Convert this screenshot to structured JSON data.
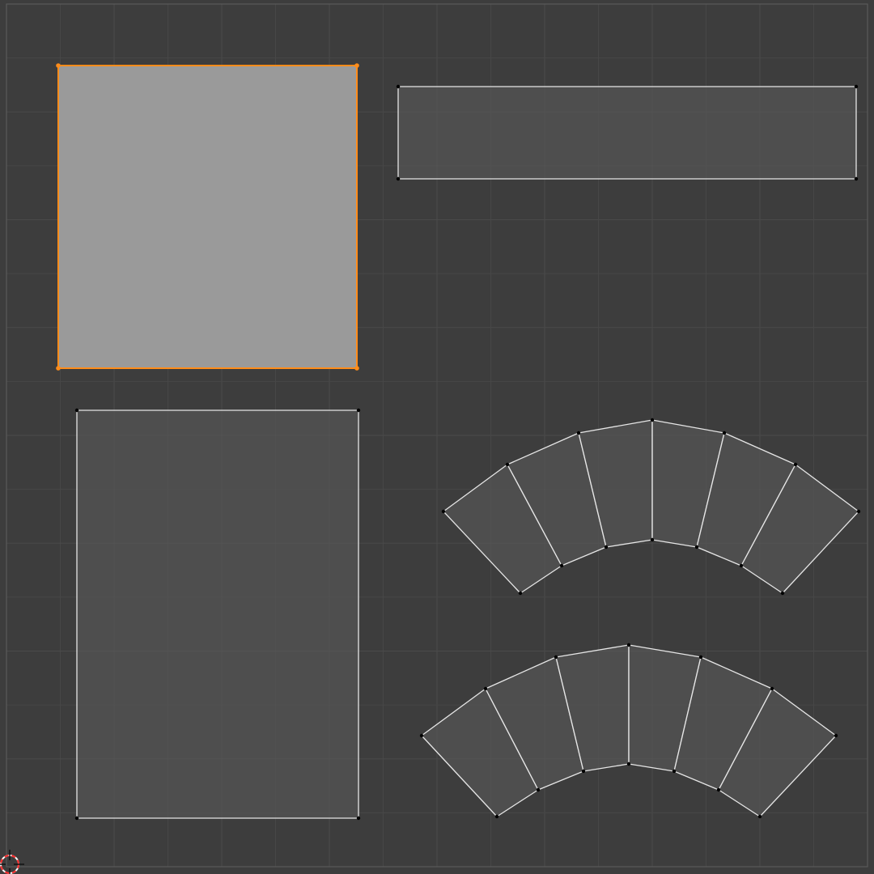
{
  "editor": {
    "background_color": "#3d3d3d",
    "grid_color": "#474747",
    "grid_major_color": "#4a4a4a",
    "image_bounds_color": "#5a5a5a",
    "face_fill_color": "#585858",
    "face_fill_opacity": 0.65,
    "edge_color": "#e6e6e6",
    "vertex_color": "#000000",
    "selected_face_fill": "#9a9a9a",
    "selected_edge_color": "#ff8c1a",
    "selected_vertex_color": "#ff8c1a"
  },
  "cursor_3d": {
    "icon": "3d-cursor-icon",
    "ring_color_a": "#ff2a2a",
    "ring_color_b": "#ffffff"
  },
  "uv_islands": [
    {
      "name": "square-island",
      "selected": true
    },
    {
      "name": "strip-island",
      "selected": false
    },
    {
      "name": "tall-island",
      "selected": false
    },
    {
      "name": "arc-island-upper",
      "selected": false,
      "face_count": 6
    },
    {
      "name": "arc-island-lower",
      "selected": false,
      "face_count": 6
    }
  ]
}
